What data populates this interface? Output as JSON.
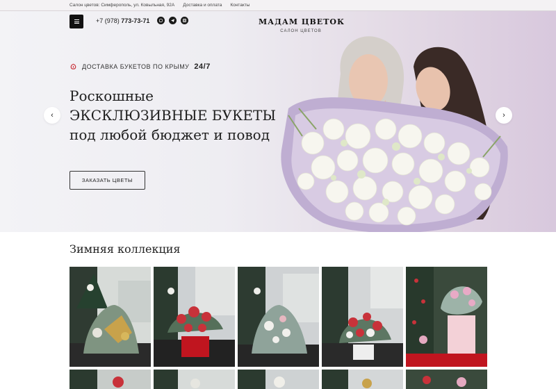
{
  "topbar": {
    "address": "Салон цветов: Симферополь, ул. Ковыльная, 92А",
    "delivery_link": "Доставка и оплата",
    "contacts_link": "Контакты"
  },
  "header": {
    "phone_prefix": "+7 (978)",
    "phone_number": "773-73-71",
    "brand_name": "МАДАМ ЦВЕТОК",
    "brand_sub": "САЛОН ЦВЕТОВ",
    "socials": [
      "whatsapp-icon",
      "telegram-icon",
      "instagram-icon"
    ]
  },
  "hero": {
    "delivery_text": "ДОСТАВКА БУКЕТОВ ПО КРЫМУ",
    "delivery_badge": "24/7",
    "headline": [
      "Роскошные",
      "ЭКСКЛЮЗИВНЫЕ БУКЕТЫ",
      "под любой бюджет и повод"
    ],
    "cta_label": "ЗАКАЗАТЬ ЦВЕТЫ",
    "prev_arrow": "‹",
    "next_arrow": "›"
  },
  "collection": {
    "title": "Зимняя коллекция",
    "cards": [
      {
        "name": "winter-bouquet-gold"
      },
      {
        "name": "winter-bouquet-red-box"
      },
      {
        "name": "winter-bouquet-white"
      },
      {
        "name": "winter-bouquet-red-white"
      },
      {
        "name": "winter-bouquet-pink-tree"
      }
    ]
  },
  "colors": {
    "accent_red": "#c8323a",
    "dark": "#111111",
    "hero_bg_right": "#d8c8dd"
  }
}
